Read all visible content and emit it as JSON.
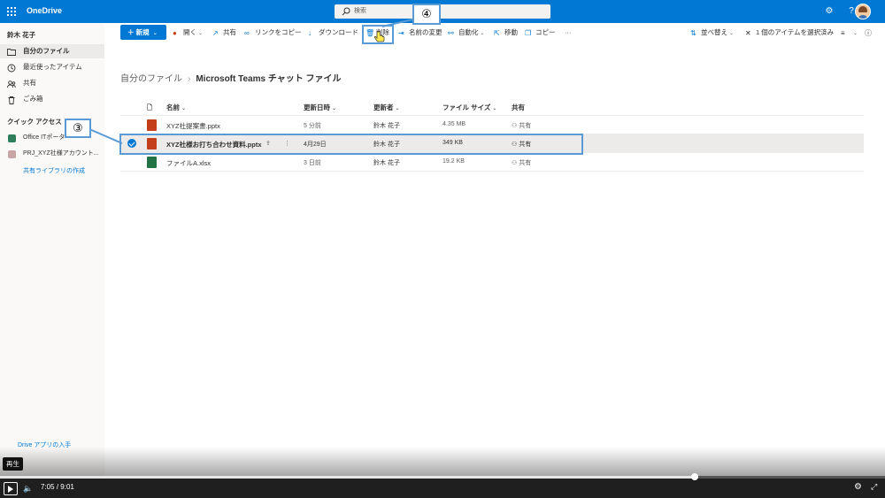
{
  "header": {
    "app_title": "OneDrive",
    "search_placeholder": "検索",
    "icons": [
      "waffle-icon",
      "gear-icon",
      "help-icon",
      "avatar"
    ]
  },
  "sidebar": {
    "user_name": "鈴木 花子",
    "items": [
      {
        "label": "自分のファイル",
        "icon": "folder-icon",
        "active": true
      },
      {
        "label": "最近使ったアイテム",
        "icon": "clock-icon"
      },
      {
        "label": "共有",
        "icon": "share-people-icon"
      },
      {
        "label": "ごみ箱",
        "icon": "trash-icon"
      }
    ],
    "quick_access_title": "クイック アクセス",
    "quick_access": [
      {
        "label": "Office ITポータ",
        "color": "#2e7d5b"
      },
      {
        "label": "PRJ_XYZ社様アカウント...",
        "color": "#c8a6a6"
      }
    ],
    "create_library": "共有ライブラリの作成",
    "get_app": "Drive アプリの入手"
  },
  "toolbar": {
    "new_label": "新規",
    "open_label": "開く",
    "share_label": "共有",
    "copy_link_label": "リンクをコピー",
    "download_label": "ダウンロード",
    "delete_label": "削除",
    "rename_label": "名前の変更",
    "automate_label": "自動化",
    "move_label": "移動",
    "copy_label": "コピー",
    "more_label": "···",
    "sort_label": "並べ替え",
    "selected_label": "1 個のアイテムを選択済み"
  },
  "breadcrumb": {
    "root": "自分のファイル",
    "current": "Microsoft Teams チャット ファイル"
  },
  "table": {
    "columns": [
      "名前",
      "更新日時",
      "更新者",
      "ファイル サイズ",
      "共有"
    ],
    "rows": [
      {
        "name": "XYZ社提案書.pptx",
        "modified": "5 分前",
        "modified_by": "鈴木 花子",
        "size": "4.35 MB",
        "sharing": "共有",
        "type": "pptx",
        "selected": false
      },
      {
        "name": "XYZ社様お打ち合わせ資料.pptx",
        "modified": "4月29日",
        "modified_by": "鈴木 花子",
        "size": "349 KB",
        "sharing": "共有",
        "type": "pptx",
        "selected": true
      },
      {
        "name": "ファイルA.xlsx",
        "modified": "3 日前",
        "modified_by": "鈴木 花子",
        "size": "19.2 KB",
        "sharing": "共有",
        "type": "xlsx",
        "selected": false
      }
    ]
  },
  "annotations": {
    "step3": "③",
    "step4": "④",
    "color": "#5b9bd5"
  },
  "video": {
    "tooltip": "再生",
    "current_time": "7:05",
    "separator": "/",
    "duration": "9:01",
    "progress_fraction": 0.785
  }
}
